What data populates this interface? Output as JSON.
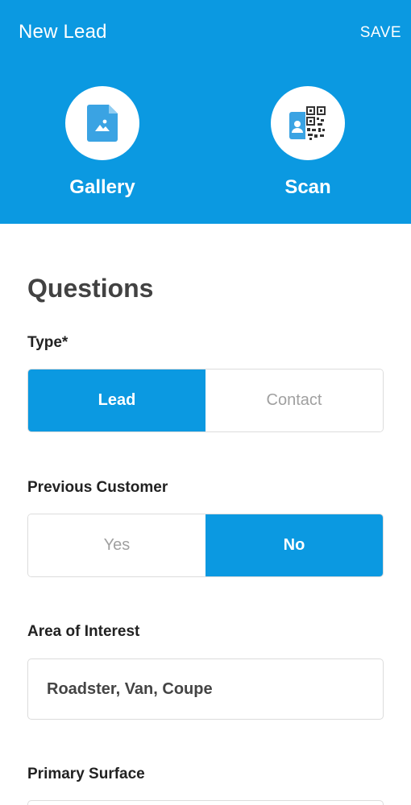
{
  "header": {
    "title": "New Lead",
    "save_label": "SAVE",
    "background_color": "#0b99e1",
    "actions": [
      {
        "label": "Gallery",
        "icon": "image-file-icon"
      },
      {
        "label": "Scan",
        "icon": "qr-contact-card-icon"
      }
    ]
  },
  "form": {
    "section_title": "Questions",
    "type": {
      "label": "Type*",
      "options": [
        "Lead",
        "Contact"
      ],
      "selected": "Lead"
    },
    "previous_customer": {
      "label": "Previous Customer",
      "options": [
        "Yes",
        "No"
      ],
      "selected": "No"
    },
    "area_of_interest": {
      "label": "Area of Interest",
      "value": "Roadster, Van, Coupe"
    },
    "primary_surface": {
      "label": "Primary Surface",
      "value": ""
    }
  }
}
